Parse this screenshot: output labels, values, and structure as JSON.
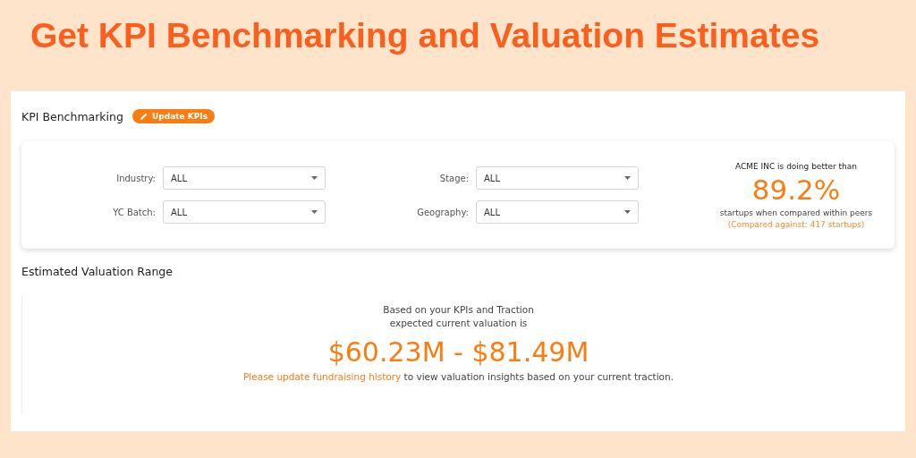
{
  "headline": "Get KPI Benchmarking and Valuation Estimates",
  "benchmarking": {
    "title": "KPI Benchmarking",
    "update_button": "Update KPIs",
    "filters": [
      {
        "label": "Industry:",
        "value": "ALL"
      },
      {
        "label": "Stage:",
        "value": "ALL"
      },
      {
        "label": "YC Batch:",
        "value": "ALL"
      },
      {
        "label": "Geography:",
        "value": "ALL"
      }
    ],
    "summary": {
      "intro": "ACME INC is doing better than",
      "percent": "89.2%",
      "caption": "startups when compared within peers",
      "note": "(Compared against: 417 startups)"
    }
  },
  "valuation": {
    "title": "Estimated Valuation Range",
    "intro_lines": [
      "Based on your KPIs and Traction",
      "expected current valuation is"
    ],
    "range": "$60.23M - $81.49M",
    "link": "Please update fundraising history",
    "message": "to view valuation insights based on your current traction."
  }
}
